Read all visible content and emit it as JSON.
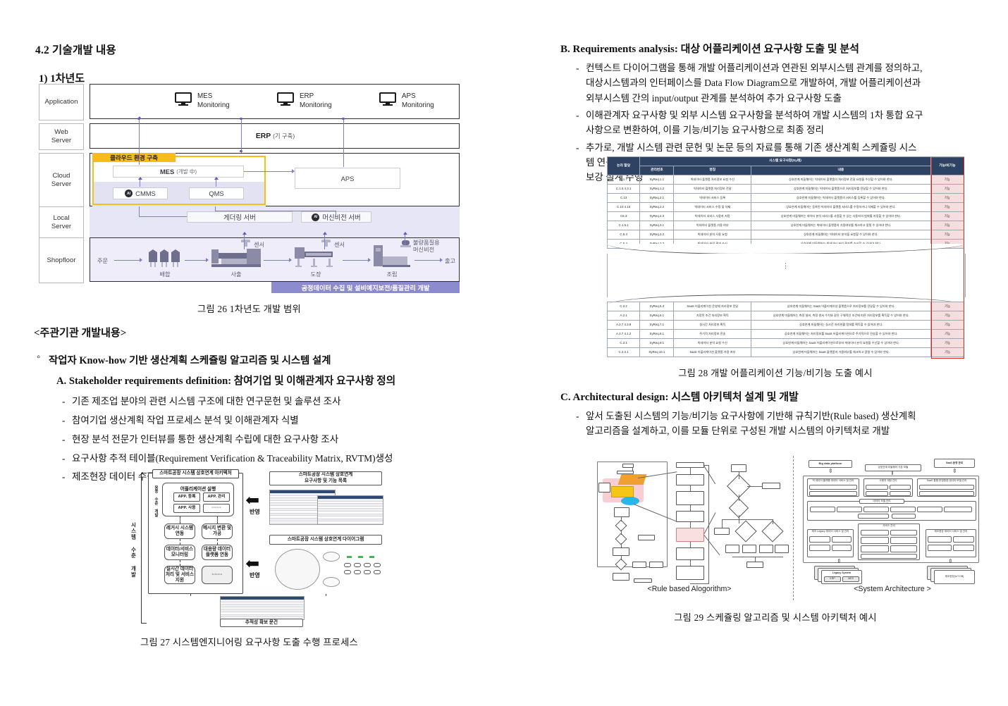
{
  "left": {
    "section_heading": "4.2 기술개발 내용",
    "subsection_heading": "1) 1차년도",
    "fig26_caption": "그림 26 1차년도 개발 범위",
    "org_heading": "<주관기관 개발내용>",
    "bullet_o": "작업자 Know-how 기반 생산계획 스케쥴링 알고리즘 및 시스템 설계",
    "item_A": "A. Stakeholder requirements definition: 참여기업 및 이해관계자 요구사항 정의",
    "dashes_A": [
      "기존 제조업 분야의 관련 시스템 구조에 대한 연구문헌 및 솔루션 조사",
      "참여기업 생산계획 작업 프로세스 분석 및 이해관계자 식별",
      "현장 분석 전문가 인터뷰를 통한 생산계획 수립에 대한 요구사항 조사",
      "요구사항 추적 테이블(Requirement Verification & Traceability Matrix, RVTM)생성",
      "제조현장 데이터 수집/분석/관리 방식 조사"
    ],
    "fig27_caption": "그림 27 시스템엔지니어링 요구사항 도출 수행 프로세스"
  },
  "right": {
    "item_B": "B. Requirements analysis: 대상 어플리케이션 요구사항 도출 및 분석",
    "dashes_B": [
      [
        "컨텍스트 다이어그램을 통해 개발 어플리케이션과 연관된 외부시스템 관계를 정의하고,",
        "대상시스템과의 인터페이스를 Data Flow Diagram으로 개발하여, 개발 어플리케이션과",
        "외부시스템 간의 input/output 관계를 분석하여 추가 요구사항 도출"
      ],
      [
        "이해관계자 요구사항 및 외부 시스템 요구사항을 분석하여 개발 시스템의 1차 통합 요구",
        "사항으로 변환하여, 이를 기능/비기능 요구사항으로 최종 정리"
      ],
      [
        "추가로, 개발 시스템 관련 문헌 및 논문 등의 자료를 통해 기존 생산계획 스케쥴링 시스",
        "템 연구/개발 관점에서 추가 기능/비기능 요구사항을 정의하여 최종 통합 요구사항을",
        "보강 설계 수행"
      ]
    ],
    "fig28_caption": "그림 28 개발 어플리케이션 기능/비기능 도출 예시",
    "item_C": "C. Architectural design: 시스템 아키텍처 설계 및 개발",
    "dashes_C": [
      [
        "앞서 도출된 시스템의 기능/비기능 요구사항에 기반해 규칙기반(Rule based) 생산계획",
        "알고리즘을 설계하고, 이를 모듈 단위로 구성된 개발 시스템의 아키텍처로 개발"
      ]
    ],
    "fig29_caption": "그림 29 스케쥴링 알고리즘 및 시스템 아키텍처 예시"
  },
  "fig26": {
    "lanes": [
      "Application",
      "Web\nServer",
      "Cloud\nServer",
      "Local\nServer",
      "Shopfloor"
    ],
    "lane_application": "Application",
    "lane_web": "Web Server",
    "lane_cloud": "Cloud Server",
    "lane_local": "Local Server",
    "lane_shopfloor": "Shopfloor",
    "monitors": [
      {
        "title": "MES",
        "sub": "Monitoring"
      },
      {
        "title": "ERP",
        "sub": "Monitoring"
      },
      {
        "title": "APS",
        "sub": "Monitoring"
      }
    ],
    "web_erp": "ERP",
    "web_erp_note": "(기 구축)",
    "cloud_tag": "클라우드 환경 구축",
    "mes_box": "MES",
    "mes_note": "(개발 中)",
    "cmms_box": "CMMS",
    "qms_box": "QMS",
    "aps_box": "APS",
    "gathering_server": "게더링 서버",
    "vision_server": "머신비전 서버",
    "shopfloor": {
      "start": "주문",
      "end": "출고",
      "stages": [
        "배합",
        "사출",
        "도장",
        "조립"
      ],
      "sensor_labels": [
        "센서",
        "센서"
      ],
      "vision_label": "불량품질용\n머신비전",
      "vision_label_l1": "불량품질용",
      "vision_label_l2": "머신비전"
    },
    "banner": "공정데이터 수집 및 설비예지보전/품질관리 개발",
    "colors": {
      "cloud_accent": "#f6bd19",
      "banner": "#8d8bd0",
      "flow_line": "#7d7ccd",
      "lane_fill": "#eeedf9"
    }
  },
  "fig27": {
    "arch_title": "스마트공장 시스템 상호연계 아키텍처",
    "side_label": "시스템 수준 개발",
    "app_group_label": "응용 수준 개발",
    "app_impl": "어플리케이션 실행",
    "app_cells": [
      "APP. 등록",
      "APP. 관리",
      "APP. 사용",
      "·······"
    ],
    "left_chain": [
      "레거시 시스템\n연동",
      "데이터/서비스\n모니터링",
      "실시간\n데이터 처리\n및 서비스 지원"
    ],
    "left_chain_1": "레거시 시스템 연동",
    "left_chain_2": "데이터/서비스 모니터링",
    "left_chain_3": "실시간 데이터 처리 및 서비스 지원",
    "right_chain_1": "메시지 변환 및 가공",
    "right_chain_2": "대용량 데이터 플랫폼 연동",
    "right_chain_3": "·······",
    "req_title": "스마트공장 시스템 상호연계\n요구사항 및 기능 목록",
    "req_title_l1": "스마트공장 시스템 상호연계",
    "req_title_l2": "요구사항 및 기능 목록",
    "diag_title": "스마트공장 시스템 상호연계 다이어그램",
    "trace_title": "추적성 확보 문건",
    "reflect_label": "반영"
  },
  "fig28_table": {
    "group_header": "시스템 요구사항(Sy레)",
    "headers": [
      "논리 할당",
      "관리번호",
      "명칭",
      "내용",
      "기능/비기능"
    ],
    "rows": [
      [
        "C.1.7",
        "SyReq.1.1",
        "빅데이터 플랫폼 처리정보 요청 수신",
        "상호연계 미들웨어는 빅데이터 플랫폼의 처리정보 전달 요청을 수신할 수 있어야 한다.",
        "기능"
      ],
      [
        "C.1.6\n4.3.1",
        "SyReq.1.2",
        "빅데이터 플랫폼 처리정보 전달",
        "상호연계 미들웨어는 빅데이터 플랫폼으로 처리정보를 전달할 수 있어야 한다.",
        "기능"
      ],
      [
        "C.13",
        "SyReq.2.1",
        "빅데이터 서비스 등록",
        "상호연계 미들웨어는 빅데이터 플랫폼의 서비스를 등록할 수 있어야 한다.",
        "기능"
      ],
      [
        "C.10\n4.10",
        "SyReq.2.2",
        "빅데이터 서비스 수정 및 삭제",
        "상호연계 미들웨어는 등록된 빅데이터 플랫폼 서비스를 수정하거나 삭제할 수 있어야 한다.",
        "기능"
      ],
      [
        "C5.3",
        "SyReq.2.3",
        "빅데이터 서비스 사용자 지정",
        "상호연계 미들웨어는 데이터 분석 서비스를 사용할 수 있는 사용자의 범위를 지정할 수 있어야 한다.",
        "기능"
      ],
      [
        "C.1.6.1",
        "SyReq.3.1",
        "빅데이터 플랫폼 가용 여부",
        "상호연계 미들웨어는 빅데이터 플랫폼의 가용여부를 체크하고 알릴 수 있어야 한다.",
        "기능"
      ],
      [
        "C.5.4",
        "SyReq.3.2",
        "빅데이터 분석 사용 요청",
        "상호연계 미들웨어는 빅데이터 분석을 요청할 수 있어야 한다.",
        "기능"
      ],
      [
        "C.5.4",
        "SyReq.3.3",
        "빅데이터 분석 결과 수신",
        "상호연계 미들웨어는 빅데이터 분석 결과를 수신할 수 있어야 한다.",
        "기능"
      ]
    ],
    "rows_bottom": [
      [
        "C.2.2",
        "SyReq.5.3",
        "SaaS 어플리케이션 운영체 처리정보 전달",
        "상호연계 미들웨어는 SaaS 어플리케이션 플랫폼으로 처리정보를 전달할 수 있어야 한다.",
        "기능"
      ],
      [
        "A.2.1",
        "SyReq.6.1",
        "지정된 조건 처리정보 획득",
        "상호연계 미들웨어는 측정 설비, 측정 센서 수치와 같은 구체적인 조건에 따른 처리정보를 획득할 수 있어야 한다.",
        "기능"
      ],
      [
        "A.2.7\n4.3.8",
        "SyReq.7.1",
        "실시간 처리정보 획득",
        "상호연계 미들웨어는 실시간 처리현황 정보를 획득할 수 있어야 한다.",
        "기능"
      ],
      [
        "A.2.7\n4.1.2",
        "SyReq.8.1",
        "주기적 처리정보 전송",
        "상호연계 미들웨어는 처리정보를 SaaS 어플리케이션으로 주기적으로 전송할 수 있어야 한다.",
        "기능"
      ],
      [
        "C.2.1",
        "SyReq.9.1",
        "빅데이터 분석 요청 수신",
        "상호연계 미들웨어는 SaaS 어플리케이션으로부터 빅데이터 분석 요청을 수신할 수 있어야 한다.",
        "기능"
      ],
      [
        "C.3.2.1",
        "SyReq.10.1",
        "SaaS 어플리케이션 플랫폼 가용 여부",
        "상호연계 미들웨어는 SaaS 플랫폼의 가용여부를 체크하고 알릴 수 있어야 한다.",
        "기능"
      ]
    ],
    "accent_color": "#e2231a",
    "header_color": "#2e4364"
  },
  "fig29": {
    "left_caption": "<Rule based Alogorithm>",
    "right_caption": "<System Architecture >",
    "sa_top": [
      "Big data platform",
      "상호연계 미들웨어 기본 모듈",
      "SaaS\n운영 관리"
    ],
    "sa_top_0": "Big data platform",
    "sa_top_1": "상호연계 미들웨어 기본 모듈",
    "sa_top_2": "SaaS 운영 관리",
    "sa_bottom_left": "Legacy System",
    "sa_bottom_left_sub": [
      "ERP",
      "MES"
    ],
    "sa_bottom_right": "제조현장(IoT DB)",
    "sa_groups": [
      "빅 데이터 플랫폼 데이터 서비스 및 관리",
      "사용자 계정 관리",
      "SaaS 통합 운영환경 데이터 모델 관리",
      "데이터 모델 관리",
      "서비스 관리",
      "제조 Legacy 데이터 서비스 및 관리",
      "제조현장 데이터 서비스 및 관리"
    ]
  }
}
